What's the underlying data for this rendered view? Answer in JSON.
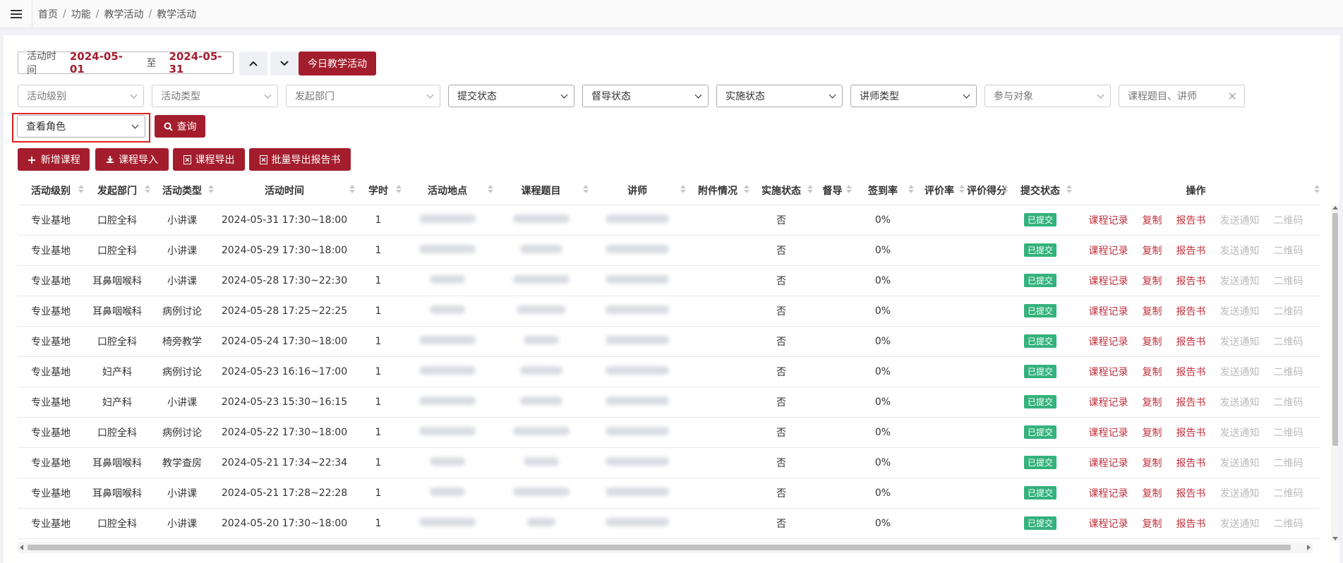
{
  "breadcrumb": [
    "首页",
    "功能",
    "教学活动",
    "教学活动"
  ],
  "date_range": {
    "label": "活动时间",
    "start": "2024-05-01",
    "to": "至",
    "end": "2024-05-31"
  },
  "today_button": "今日教学活动",
  "filters": {
    "level": "活动级别",
    "type": "活动类型",
    "dept": "发起部门",
    "submit": "提交状态",
    "supervise": "督导状态",
    "implement": "实施状态",
    "teacher_type": "讲师类型",
    "target": "参与对象",
    "search_placeholder": "课程题目、讲师",
    "role": "查看角色"
  },
  "query_button": "查询",
  "actions": {
    "add": "新增课程",
    "import": "课程导入",
    "export": "课程导出",
    "batch_export": "批量导出报告书"
  },
  "columns": [
    "活动级别",
    "发起部门",
    "活动类型",
    "活动时间",
    "学时",
    "活动地点",
    "课程题目",
    "讲师",
    "附件情况",
    "实施状态",
    "督导",
    "签到率",
    "评价率",
    "评价得分",
    "提交状态",
    "操作"
  ],
  "ops": {
    "record": "课程记录",
    "copy": "复制",
    "report": "报告书",
    "notify": "发送通知",
    "qrcode": "二维码"
  },
  "rows": [
    {
      "level": "专业基地",
      "dept": "口腔全科",
      "type": "小讲课",
      "time": "2024-05-31 17:30~18:00",
      "hours": "1",
      "impl": "否",
      "rate": "0%",
      "status": "已提交"
    },
    {
      "level": "专业基地",
      "dept": "口腔全科",
      "type": "小讲课",
      "time": "2024-05-29 17:30~18:00",
      "hours": "1",
      "impl": "否",
      "rate": "0%",
      "status": "已提交"
    },
    {
      "level": "专业基地",
      "dept": "耳鼻咽喉科",
      "type": "小讲课",
      "time": "2024-05-28 17:30~22:30",
      "hours": "1",
      "impl": "否",
      "rate": "0%",
      "status": "已提交"
    },
    {
      "level": "专业基地",
      "dept": "耳鼻咽喉科",
      "type": "病例讨论",
      "time": "2024-05-28 17:25~22:25",
      "hours": "1",
      "impl": "否",
      "rate": "0%",
      "status": "已提交"
    },
    {
      "level": "专业基地",
      "dept": "口腔全科",
      "type": "椅旁教学",
      "time": "2024-05-24 17:30~18:00",
      "hours": "1",
      "impl": "否",
      "rate": "0%",
      "status": "已提交"
    },
    {
      "level": "专业基地",
      "dept": "妇产科",
      "type": "病例讨论",
      "time": "2024-05-23 16:16~17:00",
      "hours": "1",
      "impl": "否",
      "rate": "0%",
      "status": "已提交"
    },
    {
      "level": "专业基地",
      "dept": "妇产科",
      "type": "小讲课",
      "time": "2024-05-23 15:30~16:15",
      "hours": "1",
      "impl": "否",
      "rate": "0%",
      "status": "已提交"
    },
    {
      "level": "专业基地",
      "dept": "口腔全科",
      "type": "病例讨论",
      "time": "2024-05-22 17:30~18:00",
      "hours": "1",
      "impl": "否",
      "rate": "0%",
      "status": "已提交"
    },
    {
      "level": "专业基地",
      "dept": "耳鼻咽喉科",
      "type": "教学查房",
      "time": "2024-05-21 17:34~22:34",
      "hours": "1",
      "impl": "否",
      "rate": "0%",
      "status": "已提交"
    },
    {
      "level": "专业基地",
      "dept": "耳鼻咽喉科",
      "type": "小讲课",
      "time": "2024-05-21 17:28~22:28",
      "hours": "1",
      "impl": "否",
      "rate": "0%",
      "status": "已提交"
    },
    {
      "level": "专业基地",
      "dept": "口腔全科",
      "type": "小讲课",
      "time": "2024-05-20 17:30~18:00",
      "hours": "1",
      "impl": "否",
      "rate": "0%",
      "status": "已提交"
    }
  ],
  "colors": {
    "primary": "#a31d2d",
    "badge": "#34b27b",
    "op_link": "#c0303c",
    "highlight": "#e02020"
  }
}
